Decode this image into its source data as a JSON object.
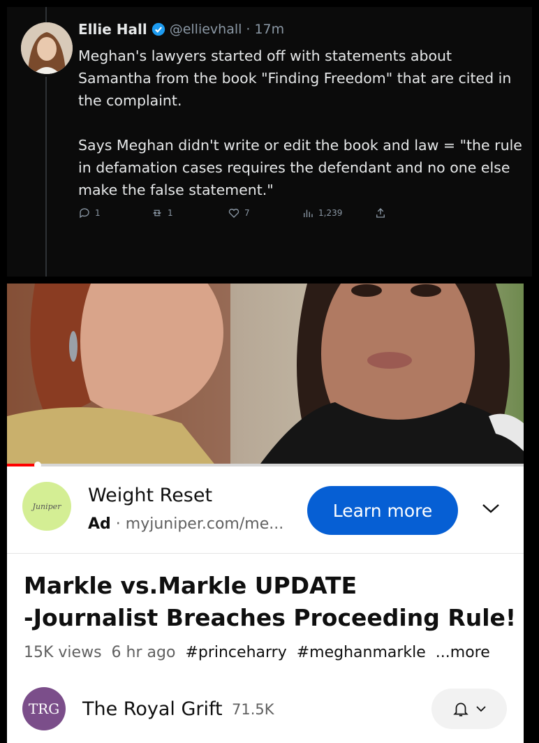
{
  "tweet": {
    "name": "Ellie Hall",
    "handle": "@ellievhall",
    "time": "17m",
    "paragraphs": [
      "Meghan's lawyers started off with statements about Samantha from the book \"Finding Freedom\" that are cited in the complaint.",
      "Says Meghan didn't write or edit the book and law = \"the rule in defamation cases requires the defendant and no one else make the false statement.\""
    ],
    "actions": {
      "reply_count": "1",
      "retweet_count": "1",
      "like_count": "7",
      "views_count": "1,239"
    }
  },
  "ad": {
    "logo_text": "Juniper",
    "title": "Weight Reset",
    "label": "Ad",
    "url": "myjuniper.com/me...",
    "cta": "Learn more"
  },
  "video": {
    "title_line1": "Markle vs.Markle UPDATE",
    "title_line2": "-Journalist Breaches Proceeding Rule!",
    "title_ellipsis": "...",
    "views": "15K views",
    "age": "6 hr ago",
    "tag1": "#princeharry",
    "tag2": "#meghanmarkle",
    "more": "...more",
    "progress_percent": 6
  },
  "channel": {
    "avatar_text": "TRG",
    "name": "The Royal Grift",
    "subscribers": "71.5K"
  },
  "colors": {
    "accent_blue": "#065fd4",
    "twitter_verified": "#1d9bf0",
    "progress_red": "#ff0000"
  }
}
